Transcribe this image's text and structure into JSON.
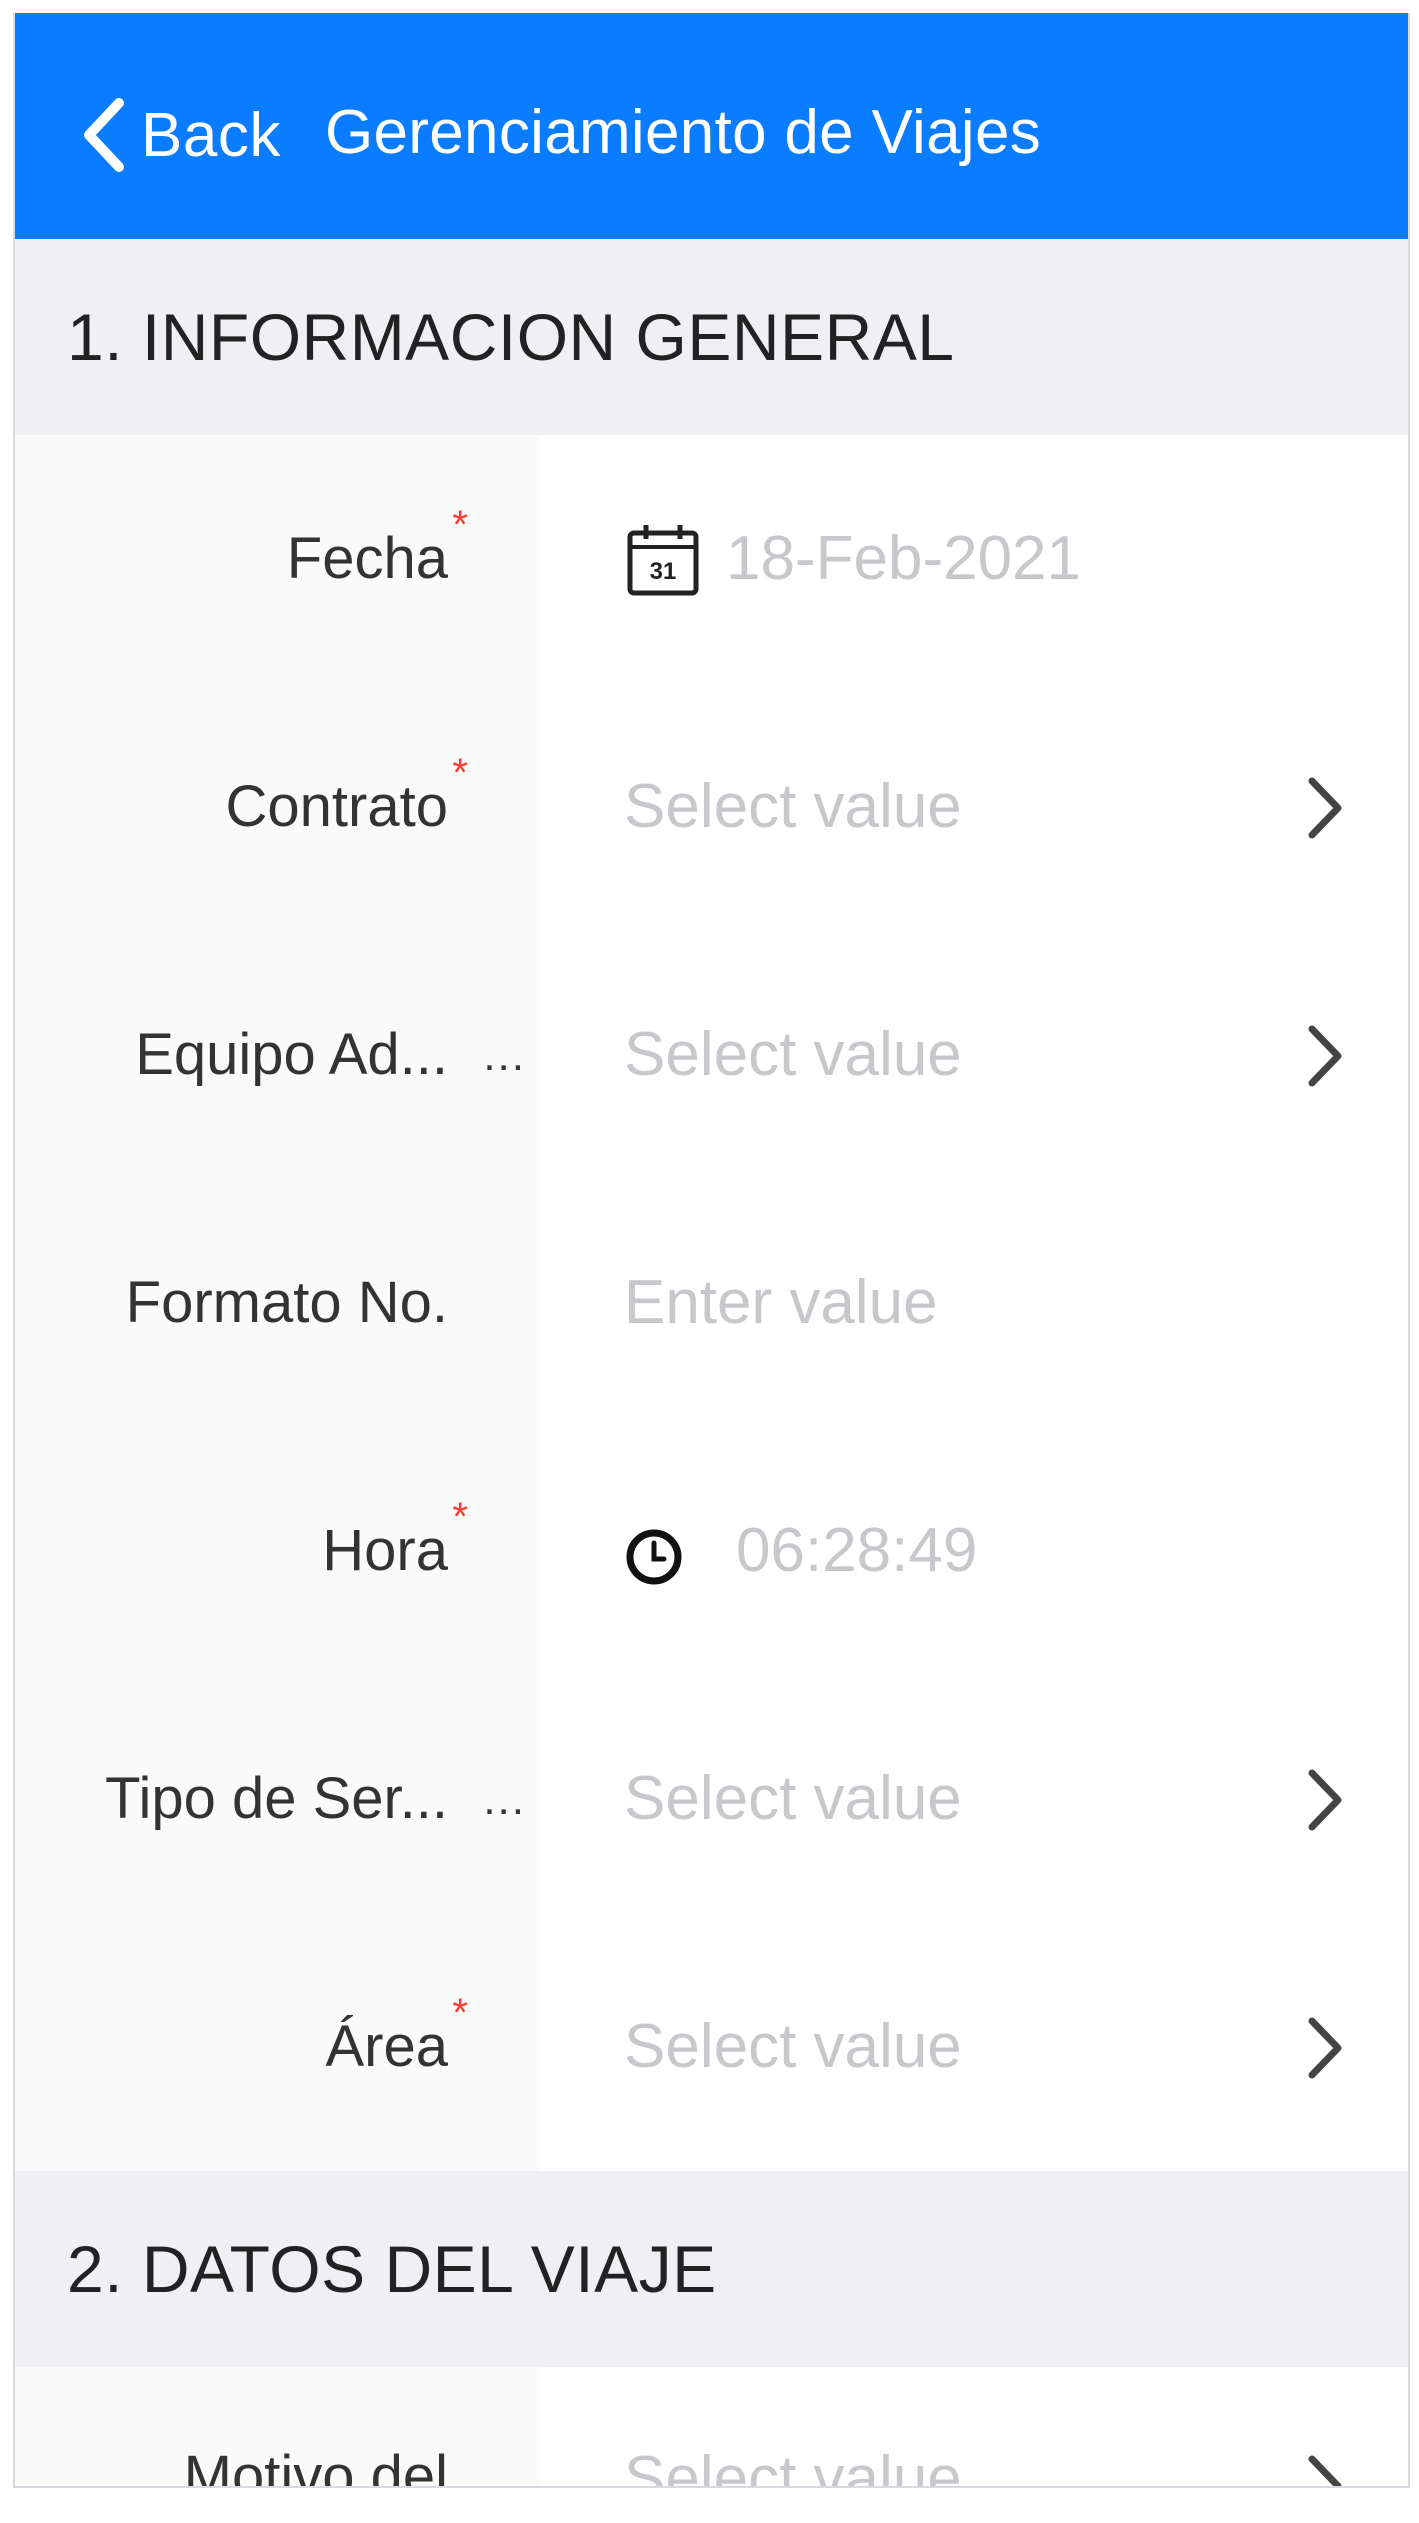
{
  "header": {
    "back_label": "Back",
    "title": "Gerenciamiento de Viajes",
    "background_color": "#0a7cff"
  },
  "sections": [
    {
      "title": "1. INFORMACION GENERAL"
    },
    {
      "title": "2. DATOS DEL VIAJE"
    }
  ],
  "fields": [
    {
      "label": "Fecha",
      "required": true,
      "value": "18-Feb-2021",
      "icon": "calendar-icon",
      "icon_text": "31"
    },
    {
      "label": "Contrato",
      "required": true,
      "placeholder": "Select value",
      "icon": "chevron-right-icon"
    },
    {
      "label": "Equipo Ad...",
      "truncated": true,
      "more": "...",
      "placeholder": "Select value",
      "icon": "chevron-right-icon"
    },
    {
      "label": "Formato No.",
      "placeholder": "Enter value"
    },
    {
      "label": "Hora",
      "required": true,
      "value": "06:28:49",
      "icon": "clock-icon"
    },
    {
      "label": "Tipo de Ser...",
      "truncated": true,
      "more": "...",
      "placeholder": "Select value",
      "icon": "chevron-right-icon"
    },
    {
      "label": "Área",
      "required": true,
      "placeholder": "Select value",
      "icon": "chevron-right-icon"
    }
  ],
  "section2_fields": [
    {
      "label": "Motivo del",
      "placeholder": "Select value",
      "icon": "chevron-right-icon"
    }
  ],
  "required_marker": "*",
  "colors": {
    "accent": "#0a7cff",
    "required": "#ff3b30",
    "section_background": "#efeff4",
    "placeholder": "#c8c8cc"
  }
}
